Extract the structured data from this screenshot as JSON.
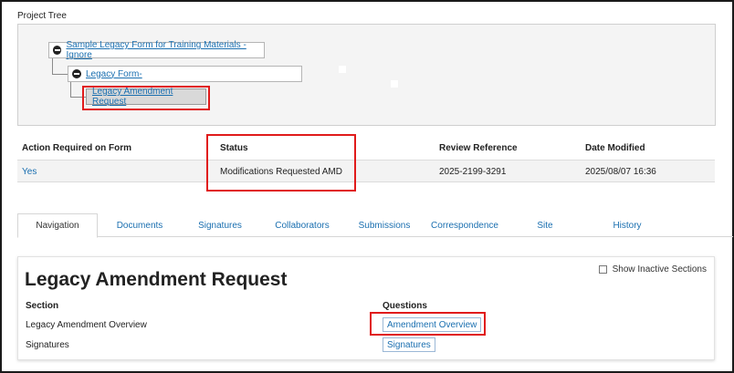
{
  "project_tree": {
    "title": "Project Tree",
    "nodes": [
      {
        "label": "Sample Legacy Form for Training Materials - Ignore"
      },
      {
        "label": "Legacy Form-"
      },
      {
        "label": "Legacy Amendment Request"
      }
    ]
  },
  "form_grid": {
    "headers": [
      "Action Required on Form",
      "Status",
      "Review Reference",
      "Date Modified"
    ],
    "row": {
      "action_required": "Yes",
      "status": "Modifications Requested AMD",
      "review_reference": "2025-2199-3291",
      "date_modified": "2025/08/07 16:36"
    }
  },
  "tabs": [
    "Navigation",
    "Documents",
    "Signatures",
    "Collaborators",
    "Submissions",
    "Correspondence",
    "Site",
    "History"
  ],
  "active_tab": "Navigation",
  "panel": {
    "title": "Legacy Amendment Request",
    "show_inactive_label": "Show Inactive Sections",
    "section_header": "Section",
    "questions_header": "Questions",
    "rows": [
      {
        "section": "Legacy Amendment Overview",
        "question": "Amendment Overview"
      },
      {
        "section": "Signatures",
        "question": "Signatures"
      }
    ]
  },
  "colors": {
    "link": "#1a6fb0",
    "highlight_red": "#e01b1b"
  }
}
